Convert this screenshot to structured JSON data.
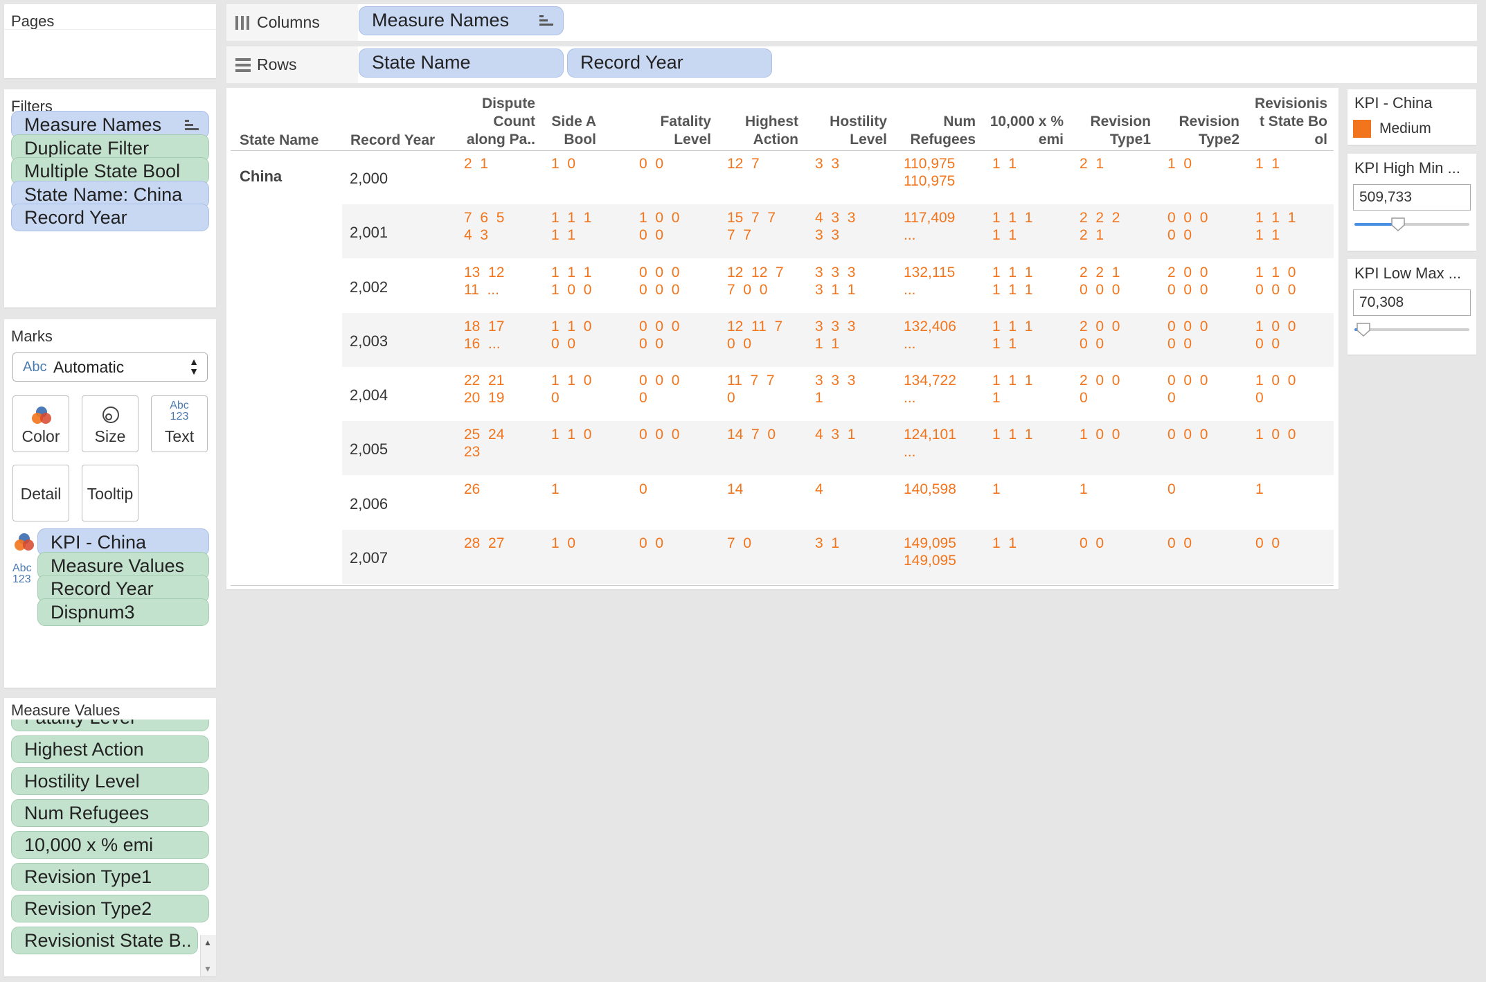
{
  "pages": {
    "title": "Pages"
  },
  "filters": {
    "title": "Filters",
    "items": [
      {
        "label": "Measure Names",
        "color": "blue",
        "sorted": true
      },
      {
        "label": "Duplicate Filter",
        "color": "green"
      },
      {
        "label": "Multiple State Bool",
        "color": "green"
      },
      {
        "label": "State Name: China",
        "color": "blue"
      },
      {
        "label": "Record Year",
        "color": "blue"
      }
    ]
  },
  "marks": {
    "title": "Marks",
    "type_icon": "Abc",
    "type": "Automatic",
    "buttons": {
      "color": "Color",
      "size": "Size",
      "text": "Text",
      "text_icon_top": "Abc",
      "text_icon_bottom": "123",
      "detail": "Detail",
      "tooltip": "Tooltip"
    },
    "pills": [
      {
        "label": "KPI - China",
        "color": "blue",
        "icon": "color-icon"
      },
      {
        "label": "Measure Values",
        "color": "green",
        "icon": "text-icon"
      },
      {
        "label": "Record Year",
        "color": "green"
      },
      {
        "label": "Dispnum3",
        "color": "green"
      }
    ],
    "text_icon_top": "Abc",
    "text_icon_bottom": "123"
  },
  "measure_values": {
    "title": "Measure Values",
    "items": [
      "Fatality Level",
      "Highest Action",
      "Hostility Level",
      "Num Refugees",
      "10,000 x % emi",
      "Revision Type1",
      "Revision Type2",
      "Revisionist State B.."
    ]
  },
  "shelves": {
    "columns_label": "Columns",
    "columns_pills": [
      "Measure Names"
    ],
    "rows_label": "Rows",
    "rows_pills": [
      "State Name",
      "Record Year"
    ]
  },
  "table": {
    "row_headers": [
      "State Name",
      "Record Year"
    ],
    "columns": [
      [
        "Dispute",
        "Count",
        "along Pa.."
      ],
      [
        "Side A",
        "Bool"
      ],
      [
        "Fatality",
        "Level"
      ],
      [
        "Highest",
        "Action"
      ],
      [
        "Hostility",
        "Level"
      ],
      [
        "Num",
        "Refugees"
      ],
      [
        "10,000 x %",
        "emi"
      ],
      [
        "Revision",
        "Type1"
      ],
      [
        "Revision",
        "Type2"
      ],
      [
        "Revisionis",
        "t State Bo",
        "ol"
      ]
    ],
    "state": "China",
    "rows": [
      {
        "year": "2,000",
        "cells": [
          [
            "2  1"
          ],
          [
            "1  0"
          ],
          [
            "0  0"
          ],
          [
            "12  7"
          ],
          [
            "3  3"
          ],
          [
            "110,975",
            "110,975"
          ],
          [
            "1  1"
          ],
          [
            "2  1"
          ],
          [
            "1  0"
          ],
          [
            "1  1"
          ]
        ]
      },
      {
        "year": "2,001",
        "cells": [
          [
            "7  6  5",
            "4  3"
          ],
          [
            "1  1  1",
            "1  1"
          ],
          [
            "1  0  0",
            "0  0"
          ],
          [
            "15  7  7",
            "7  7"
          ],
          [
            "4  3  3",
            "3  3"
          ],
          [
            "117,409",
            "..."
          ],
          [
            "1  1  1",
            "1  1"
          ],
          [
            "2  2  2",
            "2  1"
          ],
          [
            "0  0  0",
            "0  0"
          ],
          [
            "1  1  1",
            "1  1"
          ]
        ]
      },
      {
        "year": "2,002",
        "cells": [
          [
            "13  12",
            "11  ..."
          ],
          [
            "1  1  1",
            "1  0  0"
          ],
          [
            "0  0  0",
            "0  0  0"
          ],
          [
            "12  12  7",
            "7  0  0"
          ],
          [
            "3  3  3",
            "3  1  1"
          ],
          [
            "132,115",
            "..."
          ],
          [
            "1  1  1",
            "1  1  1"
          ],
          [
            "2  2  1",
            "0  0  0"
          ],
          [
            "2  0  0",
            "0  0  0"
          ],
          [
            "1  1  0",
            "0  0  0"
          ]
        ]
      },
      {
        "year": "2,003",
        "cells": [
          [
            "18  17",
            "16  ..."
          ],
          [
            "1  1  0",
            "0  0"
          ],
          [
            "0  0  0",
            "0  0"
          ],
          [
            "12  11  7",
            "0  0"
          ],
          [
            "3  3  3",
            "1  1"
          ],
          [
            "132,406",
            "..."
          ],
          [
            "1  1  1",
            "1  1"
          ],
          [
            "2  0  0",
            "0  0"
          ],
          [
            "0  0  0",
            "0  0"
          ],
          [
            "1  0  0",
            "0  0"
          ]
        ]
      },
      {
        "year": "2,004",
        "cells": [
          [
            "22  21",
            "20  19"
          ],
          [
            "1  1  0",
            "0"
          ],
          [
            "0  0  0",
            "0"
          ],
          [
            "11  7  7",
            "0"
          ],
          [
            "3  3  3",
            "1"
          ],
          [
            "134,722",
            "..."
          ],
          [
            "1  1  1",
            "1"
          ],
          [
            "2  0  0",
            "0"
          ],
          [
            "0  0  0",
            "0"
          ],
          [
            "1  0  0",
            "0"
          ]
        ]
      },
      {
        "year": "2,005",
        "cells": [
          [
            "25  24",
            "23"
          ],
          [
            "1  1  0"
          ],
          [
            "0  0  0"
          ],
          [
            "14  7  0"
          ],
          [
            "4  3  1"
          ],
          [
            "124,101",
            "..."
          ],
          [
            "1  1  1"
          ],
          [
            "1  0  0"
          ],
          [
            "0  0  0"
          ],
          [
            "1  0  0"
          ]
        ]
      },
      {
        "year": "2,006",
        "cells": [
          [
            "26"
          ],
          [
            "1"
          ],
          [
            "0"
          ],
          [
            "14"
          ],
          [
            "4"
          ],
          [
            "140,598"
          ],
          [
            "1"
          ],
          [
            "1"
          ],
          [
            "0"
          ],
          [
            "1"
          ]
        ]
      },
      {
        "year": "2,007",
        "cells": [
          [
            "28  27"
          ],
          [
            "1  0"
          ],
          [
            "0  0"
          ],
          [
            "7  0"
          ],
          [
            "3  1"
          ],
          [
            "149,095",
            "149,095"
          ],
          [
            "1  1"
          ],
          [
            "0  0"
          ],
          [
            "0  0"
          ],
          [
            "0  0"
          ]
        ]
      }
    ]
  },
  "legend": {
    "title": "KPI - China",
    "items": [
      {
        "label": "Medium",
        "color": "#f2751d"
      }
    ]
  },
  "kpi_high": {
    "title": "KPI High Min ...",
    "value": "509,733",
    "slider_fraction": 0.38
  },
  "kpi_low": {
    "title": "KPI Low Max ...",
    "value": "70,308",
    "slider_fraction": 0.08
  },
  "colors": {
    "accent": "#f2751d",
    "pill_blue": "#c9d8f2",
    "pill_green": "#c3e2cd",
    "slider": "#4a90e2"
  }
}
